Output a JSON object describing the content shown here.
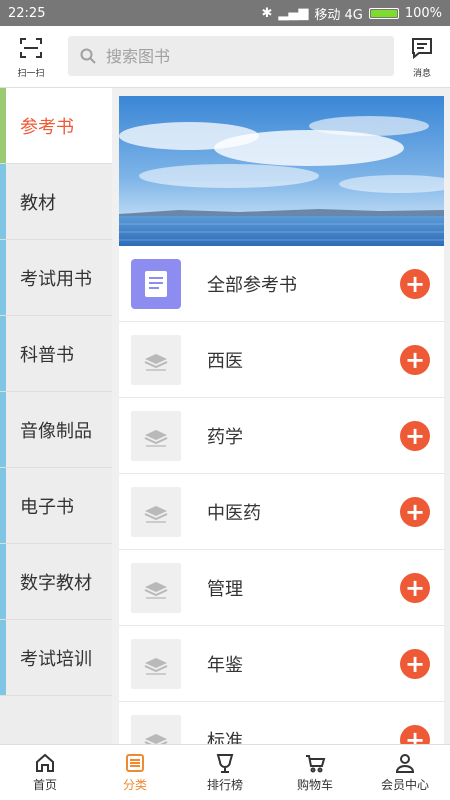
{
  "status_bar": {
    "time": "22:25",
    "carrier": "移动 4G",
    "battery": "100%",
    "battery_level": 1.0
  },
  "header": {
    "scan_label": "扫一扫",
    "search_placeholder": "搜索图书",
    "message_label": "消息"
  },
  "sidebar": {
    "items": [
      {
        "label": "参考书",
        "active": true
      },
      {
        "label": "教材",
        "active": false
      },
      {
        "label": "考试用书",
        "active": false
      },
      {
        "label": "科普书",
        "active": false
      },
      {
        "label": "音像制品",
        "active": false
      },
      {
        "label": "电子书",
        "active": false
      },
      {
        "label": "数字教材",
        "active": false
      },
      {
        "label": "考试培训",
        "active": false
      }
    ]
  },
  "categories": [
    {
      "label": "全部参考书",
      "icon": "document-icon"
    },
    {
      "label": "西医",
      "icon": "book-placeholder-icon"
    },
    {
      "label": "药学",
      "icon": "book-placeholder-icon"
    },
    {
      "label": "中医药",
      "icon": "book-placeholder-icon"
    },
    {
      "label": "管理",
      "icon": "book-placeholder-icon"
    },
    {
      "label": "年鉴",
      "icon": "book-placeholder-icon"
    },
    {
      "label": "标准",
      "icon": "book-placeholder-icon"
    }
  ],
  "tabbar": {
    "items": [
      {
        "label": "首页",
        "icon": "home-icon",
        "active": false
      },
      {
        "label": "分类",
        "icon": "category-icon",
        "active": true
      },
      {
        "label": "排行榜",
        "icon": "trophy-icon",
        "active": false
      },
      {
        "label": "购物车",
        "icon": "cart-icon",
        "active": false
      },
      {
        "label": "会员中心",
        "icon": "user-icon",
        "active": false
      }
    ]
  },
  "colors": {
    "accent": "#ee5a35",
    "active_tab": "#f08a2e",
    "side_bar": "#7ec6e3",
    "side_bar_active": "#9acb73"
  }
}
